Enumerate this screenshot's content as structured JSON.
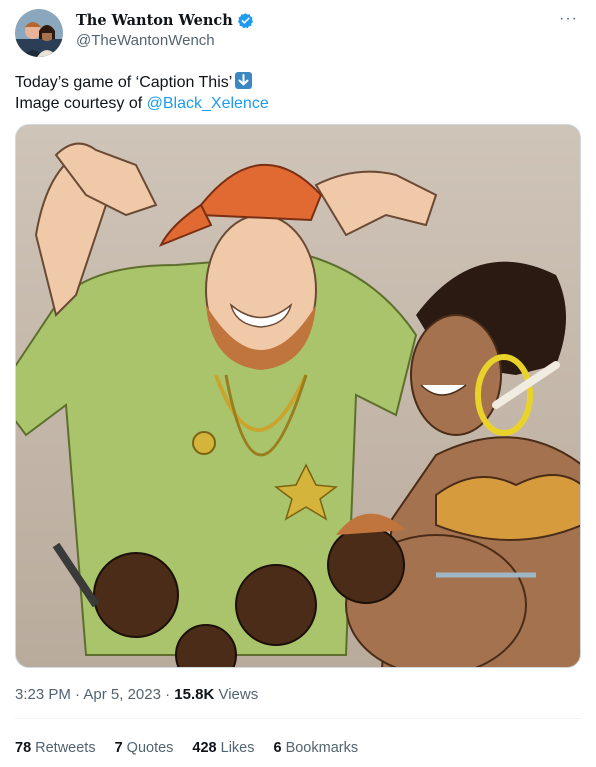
{
  "user": {
    "display_name": "The Wanton Wench",
    "handle": "@TheWantonWench",
    "verified_color": "#1d9bf0"
  },
  "header": {
    "more_label": "···"
  },
  "tweet": {
    "line1": "Today’s game of ‘Caption This’",
    "line1_emoji": "down-arrow-emoji",
    "line2_prefix": "Image courtesy of ",
    "mention": "@Black_Xelence"
  },
  "media": {
    "alt_icon": "cartoon-illustration"
  },
  "meta": {
    "time": "3:23 PM",
    "separator": " · ",
    "date": "Apr 5, 2023",
    "views_count": "15.8K",
    "views_label": " Views"
  },
  "stats": [
    {
      "count": "78",
      "label": "Retweets"
    },
    {
      "count": "7",
      "label": "Quotes"
    },
    {
      "count": "428",
      "label": "Likes"
    },
    {
      "count": "6",
      "label": "Bookmarks"
    }
  ],
  "colors": {
    "text": "#0f1419",
    "secondary": "#536471",
    "link": "#1d9bf0",
    "divider": "#eff3f4"
  }
}
